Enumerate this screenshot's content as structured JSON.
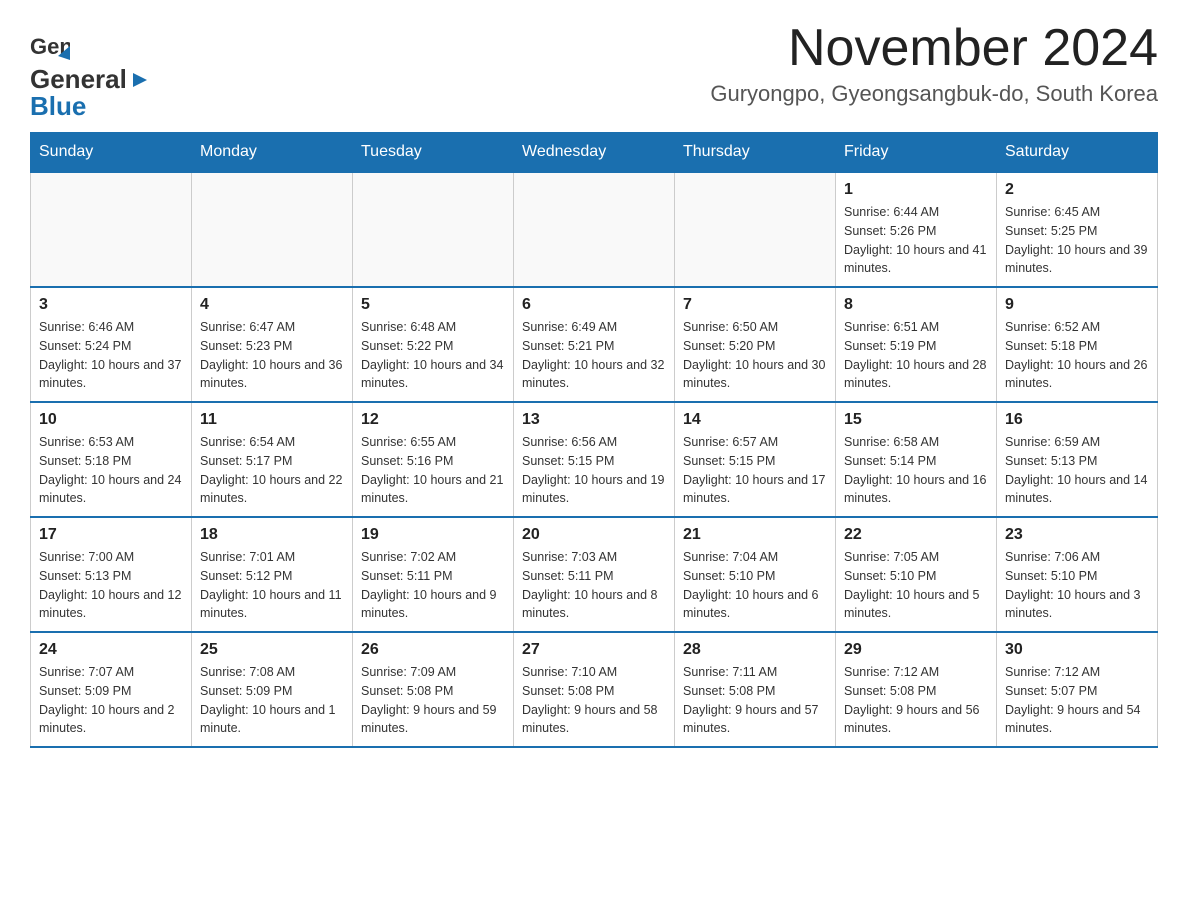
{
  "header": {
    "logo_general": "General",
    "logo_blue": "Blue",
    "title": "November 2024",
    "subtitle": "Guryongpo, Gyeongsangbuk-do, South Korea"
  },
  "calendar": {
    "days_of_week": [
      "Sunday",
      "Monday",
      "Tuesday",
      "Wednesday",
      "Thursday",
      "Friday",
      "Saturday"
    ],
    "weeks": [
      [
        {
          "day": "",
          "info": ""
        },
        {
          "day": "",
          "info": ""
        },
        {
          "day": "",
          "info": ""
        },
        {
          "day": "",
          "info": ""
        },
        {
          "day": "",
          "info": ""
        },
        {
          "day": "1",
          "info": "Sunrise: 6:44 AM\nSunset: 5:26 PM\nDaylight: 10 hours and 41 minutes."
        },
        {
          "day": "2",
          "info": "Sunrise: 6:45 AM\nSunset: 5:25 PM\nDaylight: 10 hours and 39 minutes."
        }
      ],
      [
        {
          "day": "3",
          "info": "Sunrise: 6:46 AM\nSunset: 5:24 PM\nDaylight: 10 hours and 37 minutes."
        },
        {
          "day": "4",
          "info": "Sunrise: 6:47 AM\nSunset: 5:23 PM\nDaylight: 10 hours and 36 minutes."
        },
        {
          "day": "5",
          "info": "Sunrise: 6:48 AM\nSunset: 5:22 PM\nDaylight: 10 hours and 34 minutes."
        },
        {
          "day": "6",
          "info": "Sunrise: 6:49 AM\nSunset: 5:21 PM\nDaylight: 10 hours and 32 minutes."
        },
        {
          "day": "7",
          "info": "Sunrise: 6:50 AM\nSunset: 5:20 PM\nDaylight: 10 hours and 30 minutes."
        },
        {
          "day": "8",
          "info": "Sunrise: 6:51 AM\nSunset: 5:19 PM\nDaylight: 10 hours and 28 minutes."
        },
        {
          "day": "9",
          "info": "Sunrise: 6:52 AM\nSunset: 5:18 PM\nDaylight: 10 hours and 26 minutes."
        }
      ],
      [
        {
          "day": "10",
          "info": "Sunrise: 6:53 AM\nSunset: 5:18 PM\nDaylight: 10 hours and 24 minutes."
        },
        {
          "day": "11",
          "info": "Sunrise: 6:54 AM\nSunset: 5:17 PM\nDaylight: 10 hours and 22 minutes."
        },
        {
          "day": "12",
          "info": "Sunrise: 6:55 AM\nSunset: 5:16 PM\nDaylight: 10 hours and 21 minutes."
        },
        {
          "day": "13",
          "info": "Sunrise: 6:56 AM\nSunset: 5:15 PM\nDaylight: 10 hours and 19 minutes."
        },
        {
          "day": "14",
          "info": "Sunrise: 6:57 AM\nSunset: 5:15 PM\nDaylight: 10 hours and 17 minutes."
        },
        {
          "day": "15",
          "info": "Sunrise: 6:58 AM\nSunset: 5:14 PM\nDaylight: 10 hours and 16 minutes."
        },
        {
          "day": "16",
          "info": "Sunrise: 6:59 AM\nSunset: 5:13 PM\nDaylight: 10 hours and 14 minutes."
        }
      ],
      [
        {
          "day": "17",
          "info": "Sunrise: 7:00 AM\nSunset: 5:13 PM\nDaylight: 10 hours and 12 minutes."
        },
        {
          "day": "18",
          "info": "Sunrise: 7:01 AM\nSunset: 5:12 PM\nDaylight: 10 hours and 11 minutes."
        },
        {
          "day": "19",
          "info": "Sunrise: 7:02 AM\nSunset: 5:11 PM\nDaylight: 10 hours and 9 minutes."
        },
        {
          "day": "20",
          "info": "Sunrise: 7:03 AM\nSunset: 5:11 PM\nDaylight: 10 hours and 8 minutes."
        },
        {
          "day": "21",
          "info": "Sunrise: 7:04 AM\nSunset: 5:10 PM\nDaylight: 10 hours and 6 minutes."
        },
        {
          "day": "22",
          "info": "Sunrise: 7:05 AM\nSunset: 5:10 PM\nDaylight: 10 hours and 5 minutes."
        },
        {
          "day": "23",
          "info": "Sunrise: 7:06 AM\nSunset: 5:10 PM\nDaylight: 10 hours and 3 minutes."
        }
      ],
      [
        {
          "day": "24",
          "info": "Sunrise: 7:07 AM\nSunset: 5:09 PM\nDaylight: 10 hours and 2 minutes."
        },
        {
          "day": "25",
          "info": "Sunrise: 7:08 AM\nSunset: 5:09 PM\nDaylight: 10 hours and 1 minute."
        },
        {
          "day": "26",
          "info": "Sunrise: 7:09 AM\nSunset: 5:08 PM\nDaylight: 9 hours and 59 minutes."
        },
        {
          "day": "27",
          "info": "Sunrise: 7:10 AM\nSunset: 5:08 PM\nDaylight: 9 hours and 58 minutes."
        },
        {
          "day": "28",
          "info": "Sunrise: 7:11 AM\nSunset: 5:08 PM\nDaylight: 9 hours and 57 minutes."
        },
        {
          "day": "29",
          "info": "Sunrise: 7:12 AM\nSunset: 5:08 PM\nDaylight: 9 hours and 56 minutes."
        },
        {
          "day": "30",
          "info": "Sunrise: 7:12 AM\nSunset: 5:07 PM\nDaylight: 9 hours and 54 minutes."
        }
      ]
    ]
  }
}
